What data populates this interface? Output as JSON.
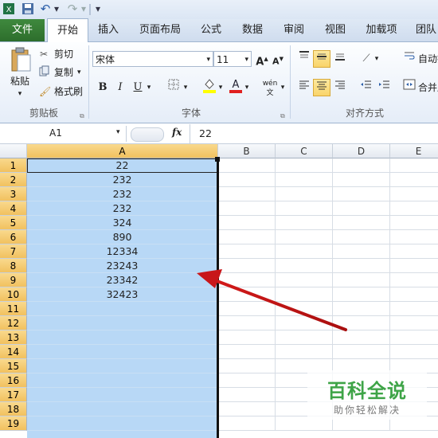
{
  "qat": {
    "dropdown_glyph": "▾"
  },
  "tabs": [
    "文件",
    "开始",
    "插入",
    "页面布局",
    "公式",
    "数据",
    "审阅",
    "视图",
    "加载项",
    "团队"
  ],
  "clipboard": {
    "paste": "粘贴",
    "cut": "剪切",
    "copy": "复制",
    "format_painter": "格式刷",
    "group": "剪贴板"
  },
  "font": {
    "name": "宋体",
    "size": "11",
    "grow": "A",
    "shrink": "A",
    "bold": "B",
    "italic": "I",
    "underline": "U",
    "wen": "wén",
    "group": "字体"
  },
  "alignment": {
    "wrap": "自动换",
    "merge": "合并后",
    "group": "对齐方式"
  },
  "formula_bar": {
    "name_box": "A1",
    "fx": "fx",
    "value": "22"
  },
  "columns": [
    "A",
    "B",
    "C",
    "D",
    "E"
  ],
  "rows": [
    "1",
    "2",
    "3",
    "4",
    "5",
    "6",
    "7",
    "8",
    "9",
    "10",
    "11",
    "12",
    "13",
    "14",
    "15",
    "16",
    "17",
    "18",
    "19"
  ],
  "cells_a": [
    "22",
    "232",
    "232",
    "232",
    "324",
    "890",
    "12334",
    "23243",
    "23342",
    "32423"
  ],
  "watermark": {
    "title": "百科全说",
    "subtitle": "助你轻松解决"
  }
}
